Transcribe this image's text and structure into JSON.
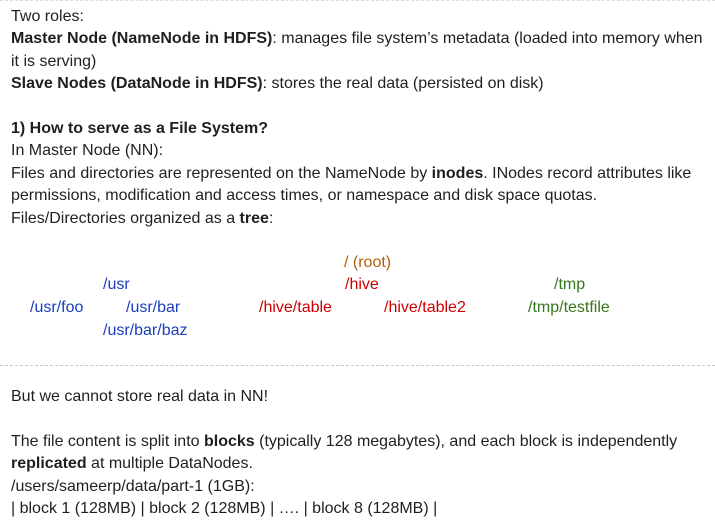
{
  "intro": {
    "roles_heading": "Two roles:",
    "master_bold": "Master Node (NameNode in HDFS)",
    "master_text": ": manages file system’s metadata (loaded into memory when it is serving)",
    "slave_bold": "Slave Nodes (DataNode in HDFS)",
    "slave_text": ": stores the real data (persisted on disk)"
  },
  "fs": {
    "heading": "1) How to serve as a File System?",
    "line1": "In Master Node (NN):",
    "line2_a": "Files and directories are represented on the NameNode by ",
    "line2_bold": "inodes",
    "line2_b": ". INodes record attributes like permissions, modification and access times, or namespace and disk space quotas.",
    "line3_a": "Files/Directories organized as a ",
    "line3_bold": "tree",
    "line3_b": ":"
  },
  "tree": {
    "root": "/ (root)",
    "usr": "/usr",
    "hive": "/hive",
    "tmp": "/tmp",
    "usr_foo": "/usr/foo",
    "usr_bar": "/usr/bar",
    "hive_table": "/hive/table",
    "hive_table2": "/hive/table2",
    "tmp_testfile": "/tmp/testfile",
    "usr_bar_baz": "/usr/bar/baz",
    "colors": {
      "blue": "#1a3dbf",
      "red": "#cc0000",
      "green": "#38761d",
      "brown": "#b45f06"
    }
  },
  "data": {
    "line1": "But we cannot store real data in NN!",
    "line2_a": "The file content is split into ",
    "line2_bold1": "blocks",
    "line2_b": " (typically 128 megabytes), and each block is independently ",
    "line2_bold2": "replicated",
    "line2_c": " at multiple DataNodes.",
    "line3": "/users/sameerp/data/part-1 (1GB):",
    "line4": "| block 1 (128MB) | block 2 (128MB) | ….  | block 8 (128MB) |"
  }
}
